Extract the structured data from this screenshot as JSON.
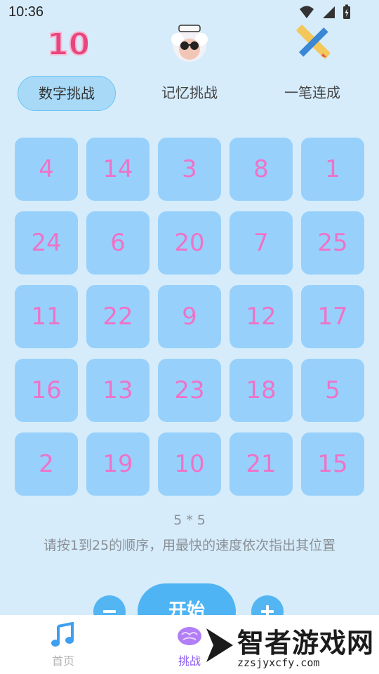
{
  "status_bar": {
    "time": "10:36"
  },
  "header_icons": [
    "number-10-icon",
    "sheep-sunglasses-icon",
    "pencil-ruler-icon"
  ],
  "tabs": [
    {
      "label": "数字挑战",
      "active": true
    },
    {
      "label": "记忆挑战",
      "active": false
    },
    {
      "label": "一笔连成",
      "active": false
    }
  ],
  "grid": {
    "rows": 5,
    "cols": 5,
    "cells": [
      "4",
      "14",
      "3",
      "8",
      "1",
      "24",
      "6",
      "20",
      "7",
      "25",
      "11",
      "22",
      "9",
      "12",
      "17",
      "16",
      "13",
      "23",
      "18",
      "5",
      "2",
      "19",
      "10",
      "21",
      "15"
    ]
  },
  "size_label": "5 * 5",
  "instructions": "请按1到25的顺序，用最快的速度依次指出其位置",
  "controls": {
    "start_label": "开始"
  },
  "bottom_nav": [
    {
      "label": "首页",
      "active": false
    },
    {
      "label": "挑战",
      "active": true
    }
  ],
  "watermark": {
    "text": "智者游戏网",
    "url": "zzsjyxcfy.com"
  },
  "colors": {
    "background": "#d6ecfb",
    "cell": "#97d1fb",
    "number": "#ee73c8",
    "accent": "#4fb4f3",
    "active_nav": "#8a5cf0"
  }
}
